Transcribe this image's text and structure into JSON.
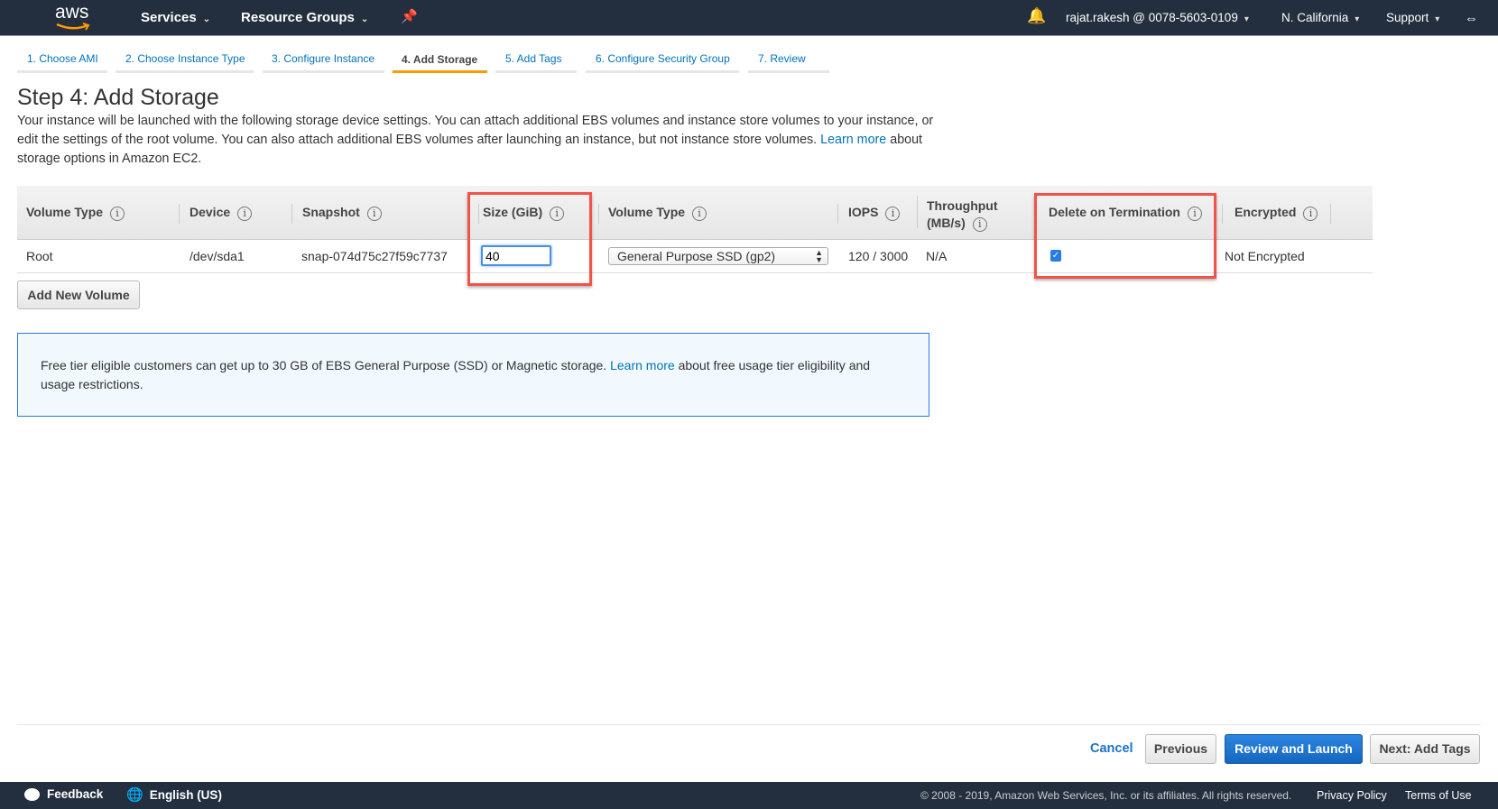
{
  "topbar": {
    "logo": "aws",
    "services": "Services",
    "resource_groups": "Resource Groups",
    "account": "rajat.rakesh @ 0078-5603-0109",
    "region": "N. California",
    "support": "Support"
  },
  "tabs": [
    "1. Choose AMI",
    "2. Choose Instance Type",
    "3. Configure Instance",
    "4. Add Storage",
    "5. Add Tags",
    "6. Configure Security Group",
    "7. Review"
  ],
  "active_tab": "4. Add Storage",
  "page": {
    "title": "Step 4: Add Storage",
    "desc1": "Your instance will be launched with the following storage device settings. You can attach additional EBS volumes and instance store volumes to your instance, or",
    "desc2a": "edit the settings of the root volume. You can also attach additional EBS volumes after launching an instance, but not instance store volumes.",
    "learn_more": "Learn more",
    "desc2b": "about",
    "desc3": "storage options in Amazon EC2."
  },
  "table": {
    "headers": {
      "volume_type": "Volume Type",
      "device": "Device",
      "snapshot": "Snapshot",
      "size": "Size (GiB)",
      "vol_type": "Volume Type",
      "iops": "IOPS",
      "throughput1": "Throughput",
      "throughput2": "(MB/s)",
      "delete": "Delete on Termination",
      "encrypted": "Encrypted"
    },
    "row": {
      "volume_type": "Root",
      "device": "/dev/sda1",
      "snapshot": "snap-074d75c27f59c7737",
      "size": "40",
      "vol_type": "General Purpose SSD (gp2)",
      "iops": "120 / 3000",
      "throughput": "N/A",
      "delete_checked": true,
      "encrypted": "Not Encrypted"
    }
  },
  "add_volume": "Add New Volume",
  "notice": {
    "text1": "Free tier eligible customers can get up to 30 GB of EBS General Purpose (SSD) or Magnetic storage.",
    "learn_more": "Learn more",
    "text2": "about free usage tier eligibility and",
    "text3": "usage restrictions."
  },
  "buttons": {
    "cancel": "Cancel",
    "previous": "Previous",
    "review": "Review and Launch",
    "next": "Next: Add Tags"
  },
  "footer": {
    "feedback": "Feedback",
    "language": "English (US)",
    "copyright": "© 2008 - 2019, Amazon Web Services, Inc. or its affiliates. All rights reserved.",
    "privacy": "Privacy Policy",
    "terms": "Terms of Use"
  },
  "colors": {
    "accent": "#ff9900",
    "link": "#0073bb",
    "primary": "#1a73c8",
    "highlight": "#f35248",
    "nav": "#232f3e"
  }
}
